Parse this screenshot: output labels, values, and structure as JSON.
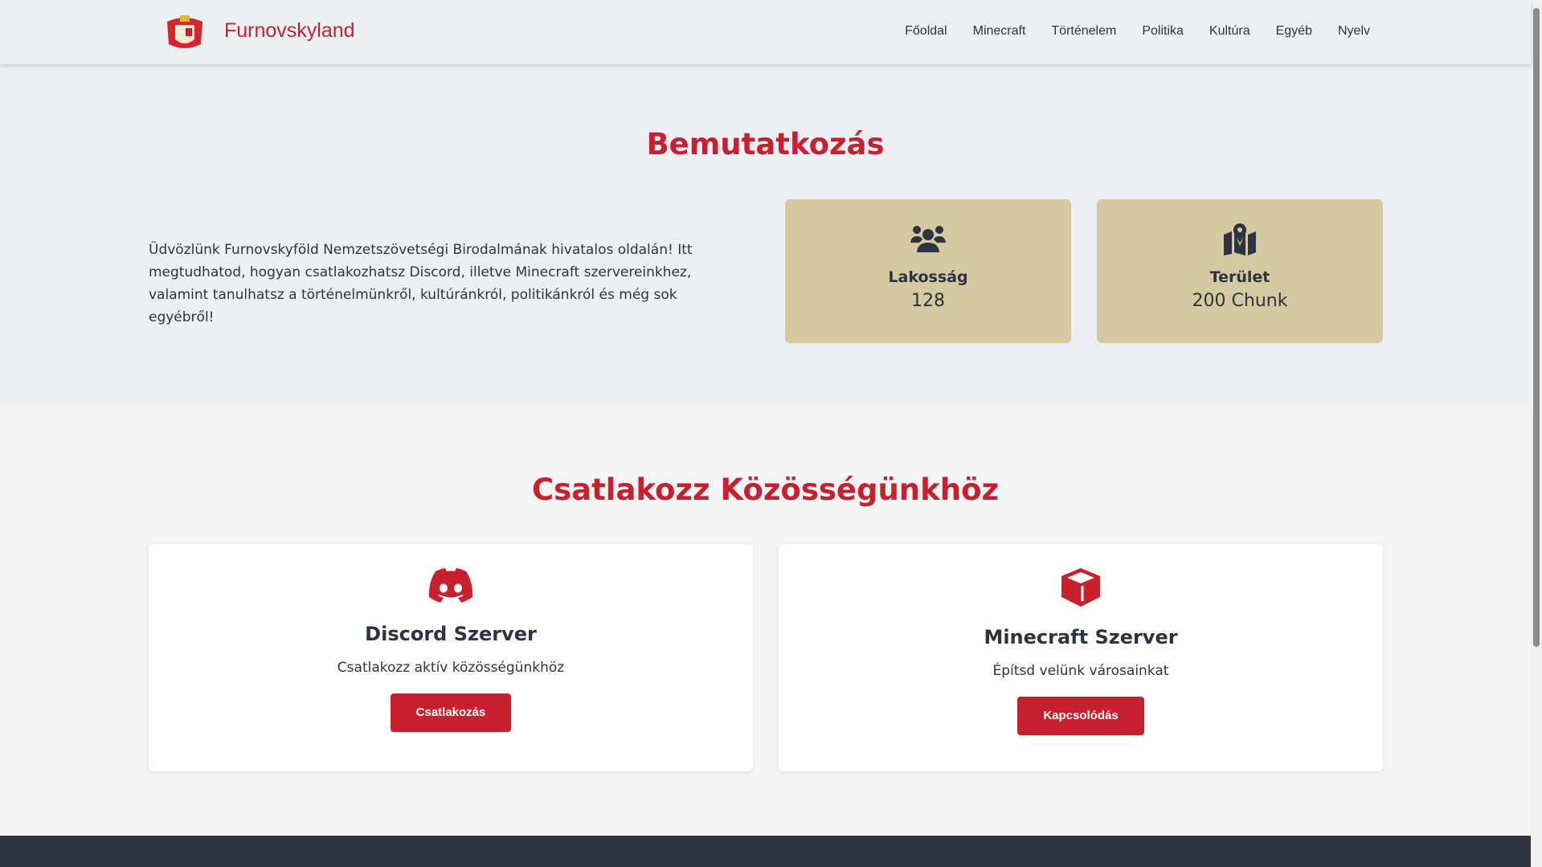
{
  "header": {
    "brand": "Furnovskyland",
    "nav": [
      "Főoldal",
      "Minecraft",
      "Történelem",
      "Politika",
      "Kultúra",
      "Egyéb",
      "Nyelv"
    ]
  },
  "intro": {
    "title": "Bemutatkozás",
    "text": "Üdvözlünk Furnovskyföld Nemzetszövetségi Birodalmának hivatalos oldalán! Itt megtudhatod, hogyan csatlakozhatsz Discord, illetve Minecraft szervereinkhez, valamint tanulhatsz a történelmünkről, kultúránkról, politikánkról és még sok egyébről!",
    "stats": [
      {
        "icon": "users-icon",
        "label": "Lakosság",
        "value": "128"
      },
      {
        "icon": "map-location-icon",
        "label": "Terület",
        "value": "200 Chunk"
      }
    ]
  },
  "community": {
    "title": "Csatlakozz Közösségünkhöz",
    "cards": [
      {
        "icon": "discord-icon",
        "title": "Discord Szerver",
        "text": "Csatlakozz aktív közösségünkhöz",
        "button": "Csatlakozás"
      },
      {
        "icon": "cube-icon",
        "title": "Minecraft Szerver",
        "text": "Építsd velünk városainkat",
        "button": "Kapcsolódás"
      }
    ]
  },
  "colors": {
    "accent": "#c8202f",
    "stat_bg": "#d4c9a0",
    "footer": "#2d3440"
  }
}
